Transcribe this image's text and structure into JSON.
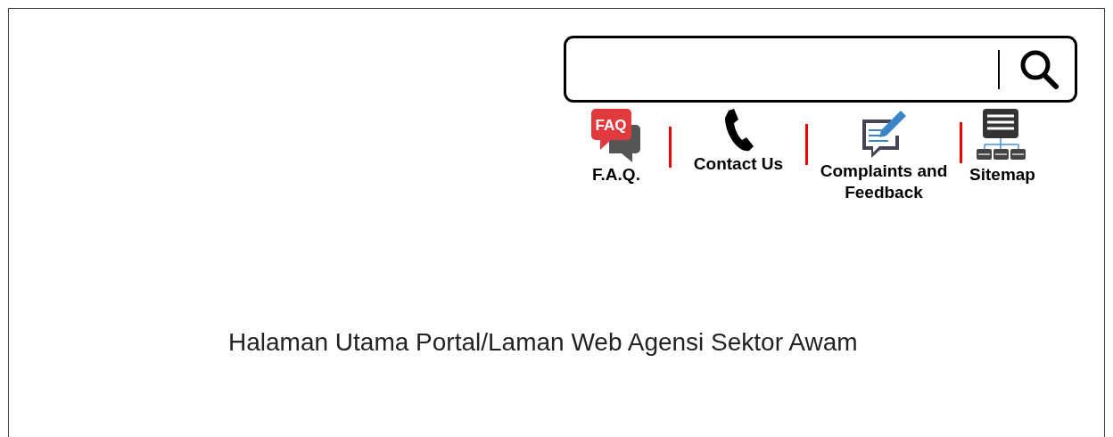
{
  "quick_links": [
    {
      "kind": "faq",
      "label": "F.A.Q.",
      "icon_text": "FAQ"
    },
    {
      "kind": "phone",
      "label": "Contact Us"
    },
    {
      "kind": "feedback",
      "label": "Complaints and Feedback"
    },
    {
      "kind": "sitemap",
      "label": "Sitemap"
    }
  ],
  "caption": "Halaman Utama Portal/Laman Web Agensi Sektor Awam"
}
